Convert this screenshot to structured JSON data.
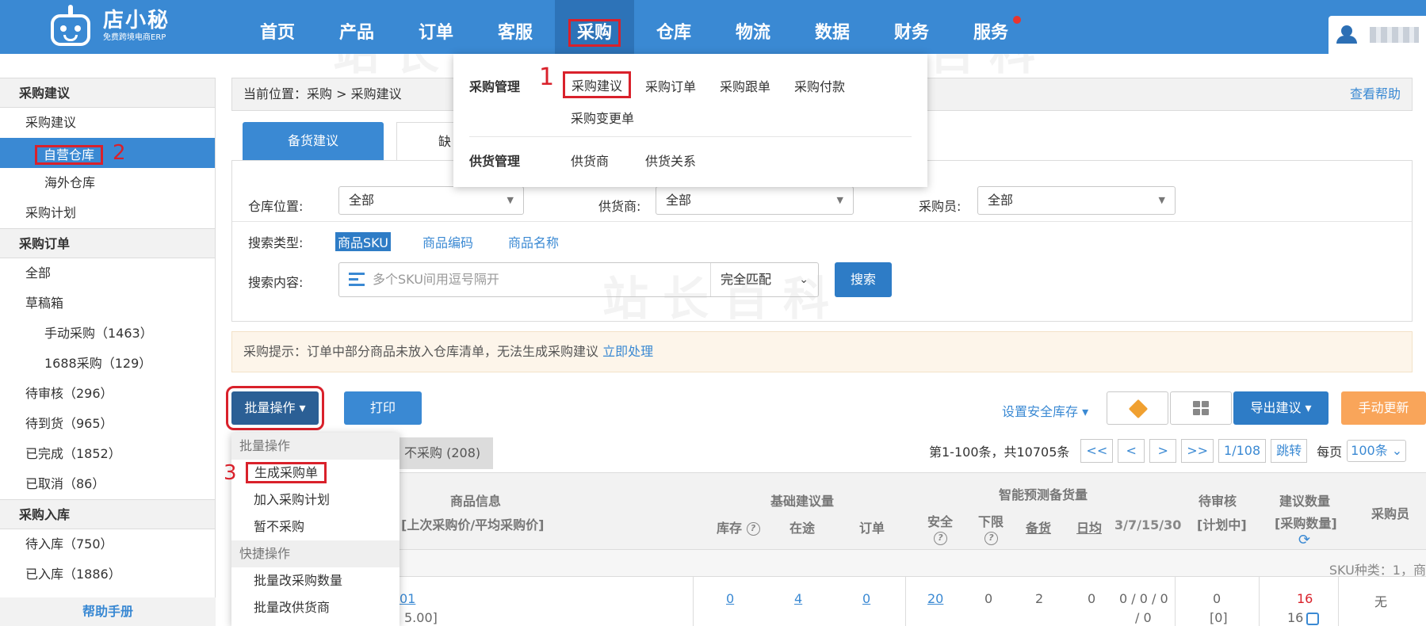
{
  "brand": {
    "name": "店小秘",
    "tagline": "免费跨境电商ERP"
  },
  "nav": {
    "items": [
      {
        "label": "首页"
      },
      {
        "label": "产品"
      },
      {
        "label": "订单"
      },
      {
        "label": "客服"
      },
      {
        "label": "采购"
      },
      {
        "label": "仓库"
      },
      {
        "label": "物流"
      },
      {
        "label": "数据"
      },
      {
        "label": "财务"
      },
      {
        "label": "服务"
      }
    ],
    "active": "采购"
  },
  "nav_dropdown": {
    "group1": "采购管理",
    "group1_links": [
      "采购建议",
      "采购订单",
      "采购跟单",
      "采购付款",
      "采购变更单"
    ],
    "group2": "供货管理",
    "group2_links": [
      "供货商",
      "供货关系"
    ],
    "step": "1"
  },
  "sidebar": {
    "g1": "采购建议",
    "g1_items": [
      "采购建议",
      "自营仓库",
      "海外仓库",
      "采购计划"
    ],
    "g2": "采购订单",
    "g2_items": [
      "全部",
      "草稿箱",
      "手动采购（1463）",
      "1688采购（129）",
      "待审核（296）",
      "待到货（965）",
      "已完成（1852）",
      "已取消（86）"
    ],
    "g3": "采购入库",
    "g3_items": [
      "待入库（750）",
      "已入库（1886）"
    ],
    "help": "帮助手册",
    "step": "2"
  },
  "breadcrumb": {
    "text": "当前位置：采购 > 采购建议",
    "help": "查看帮助"
  },
  "tabs": {
    "main": "备货建议",
    "second": "缺"
  },
  "filters": {
    "warehouse_label": "仓库位置:",
    "warehouse_value": "全部",
    "supplier_label": "供货商:",
    "supplier_value": "全部",
    "buyer_label": "采购员:",
    "buyer_value": "全部",
    "search_type_label": "搜索类型:",
    "search_types": [
      "商品SKU",
      "商品编码",
      "商品名称"
    ],
    "search_content_label": "搜索内容:",
    "search_placeholder": "多个SKU间用逗号隔开",
    "match_mode": "完全匹配",
    "search_button": "搜索"
  },
  "notice": {
    "text": "采购提示：订单中部分商品未放入仓库清单，无法生成采购建议",
    "link": "立即处理"
  },
  "toolbar": {
    "batch": "批量操作 ▾",
    "print": "打印",
    "safe_stock": "设置安全库存 ▾",
    "export": "导出建议 ▾",
    "manual": "手动更新"
  },
  "batch_dropdown": {
    "head1": "批量操作",
    "items1": [
      "生成采购单",
      "加入采购计划",
      "暂不采购"
    ],
    "head2": "快捷操作",
    "items2": [
      "批量改采购数量",
      "批量改供货商"
    ],
    "step": "3"
  },
  "subtab": "不采购 (208)",
  "pager": {
    "info": "第1-100条，共10705条",
    "first": "<<",
    "prev": "<",
    "next": ">",
    "last": ">>",
    "page": "1/108",
    "jump": "跳转",
    "per_label": "每页",
    "per_value": "100条 ⌄"
  },
  "table": {
    "col_product": "商品信息",
    "col_product_sub": "[上次采购价/平均采购价]",
    "col_basic": "基础建议量",
    "col_stock": "库存",
    "col_transit": "在途",
    "col_order": "订单",
    "col_smart": "智能预测备货量",
    "col_safe": "安全",
    "col_lower": "下限",
    "col_prep": "备货",
    "col_daily": "日均",
    "col_days": "3/7/15/30",
    "col_pending": "待审核",
    "col_pending_sub": "[计划中]",
    "col_suggest": "建议数量",
    "col_suggest_sub": "[采购数量]",
    "col_buyer": "采购员",
    "sku_count": "SKU种类：1，商",
    "row": {
      "sku_frag": "01",
      "price_frag": "5.00]",
      "stock": "0",
      "transit": "4",
      "order": "0",
      "safe": "20",
      "lower": "0",
      "prep": "2",
      "daily": "0",
      "days_a": "0 / 0 / 0",
      "days_b": "/ 0",
      "pending": "0",
      "pending_sub": "[0]",
      "suggest": "16",
      "suggest_sub": "16",
      "buyer": "无"
    }
  },
  "colors": {
    "primary": "#3a89d3",
    "highlight": "#d9212b",
    "orange": "#f9a55a"
  }
}
